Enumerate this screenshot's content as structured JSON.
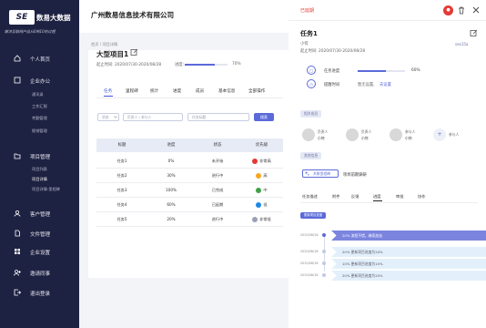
{
  "app": {
    "logo": "SE",
    "brand": "数易大数据",
    "slogan": "解决互联网产品从0到10的过程"
  },
  "sidebar": {
    "items": [
      {
        "label": "个人首页",
        "icon": "home-icon"
      },
      {
        "label": "企业办公",
        "icon": "office-icon"
      },
      {
        "label": "项目管理",
        "icon": "project-icon"
      },
      {
        "label": "客户管理",
        "icon": "customer-icon"
      },
      {
        "label": "文件管理",
        "icon": "file-icon"
      },
      {
        "label": "企业设置",
        "icon": "settings-icon"
      },
      {
        "label": "邀请同事",
        "icon": "invite-icon"
      },
      {
        "label": "退出登录",
        "icon": "logout-icon"
      }
    ],
    "office_sub": [
      "通讯录",
      "工作汇报",
      "考勤管理",
      "报销管理"
    ],
    "project_sub": [
      "项目列表",
      "项目详情",
      "项目详情-里程碑"
    ]
  },
  "header": {
    "company": "广州数易信息技术有限公司",
    "breadcrumb": "首页 \\ 项目详情"
  },
  "project": {
    "title": "大型项目1",
    "time": "起止时间: 2020/07/30-2020/08/28",
    "progress_label": "进度:",
    "progress_value": "70%",
    "progress_fraction": 0.7
  },
  "tabs": [
    "任务",
    "里程碑",
    "统计",
    "进度",
    "成员",
    "基本信息",
    "全部操作"
  ],
  "filters": {
    "status": "状态",
    "owner": "负责人 / 参与人",
    "task_title": "任务标题",
    "search_btn": "搜索"
  },
  "table": {
    "headers": [
      "标题",
      "进度",
      "状态",
      "优先级"
    ],
    "rows": [
      {
        "title": "任务1",
        "progress": "0%",
        "status": "未开始",
        "priority": "非常高",
        "color": "#e53935"
      },
      {
        "title": "任务2",
        "progress": "30%",
        "status": "进行中",
        "priority": "高",
        "color": "#f5a623"
      },
      {
        "title": "任务3",
        "progress": "100%",
        "status": "已完成",
        "priority": "中",
        "color": "#43a047"
      },
      {
        "title": "任务4",
        "progress": "60%",
        "status": "已延期",
        "priority": "低",
        "color": "#1e88e5"
      },
      {
        "title": "任务5",
        "progress": "20%",
        "status": "进行中",
        "priority": "非常低",
        "color": "#9aa0b5"
      }
    ]
  },
  "panel": {
    "overdue": "已延期",
    "task_title": "任务1",
    "creator": "小何",
    "time": "起止时间: 2020/07/30-2020/08/28",
    "code": "sex15a",
    "progress_label": "任务进度",
    "progress_value": "60%",
    "progress_fraction": 0.6,
    "remind_label": "提醒时间",
    "remind_value": "暂无设置,",
    "remind_link": "去设置",
    "members_chip": "相关成员",
    "members": [
      {
        "role": "负责人",
        "name": "小何"
      },
      {
        "role": "负责人",
        "name": "小何"
      },
      {
        "role": "参与人",
        "name": "小何"
      },
      {
        "role": "参与人",
        "name": ""
      }
    ],
    "milestone_chip": "其他信息",
    "milestone_btn": "关联里程碑",
    "milestone_text": "项目前期调研",
    "subtabs": [
      "任务描述",
      "附件",
      "反馈",
      "进度",
      "审批",
      "协作"
    ],
    "active_subtab": "进度",
    "update_btn": "更新项目进度",
    "timeline": [
      {
        "date": "2020/08/26",
        "text": "20%  流程不错，继续加油",
        "active": true
      },
      {
        "date": "2020/08/18",
        "text": "20%  更新项目进度为20%",
        "active": false
      },
      {
        "date": "2020/08/18",
        "text": "10%  更新项目进度为10%",
        "active": false
      },
      {
        "date": "2020/08/18",
        "text": "20%  更新项目进度为20%",
        "active": false
      }
    ]
  }
}
